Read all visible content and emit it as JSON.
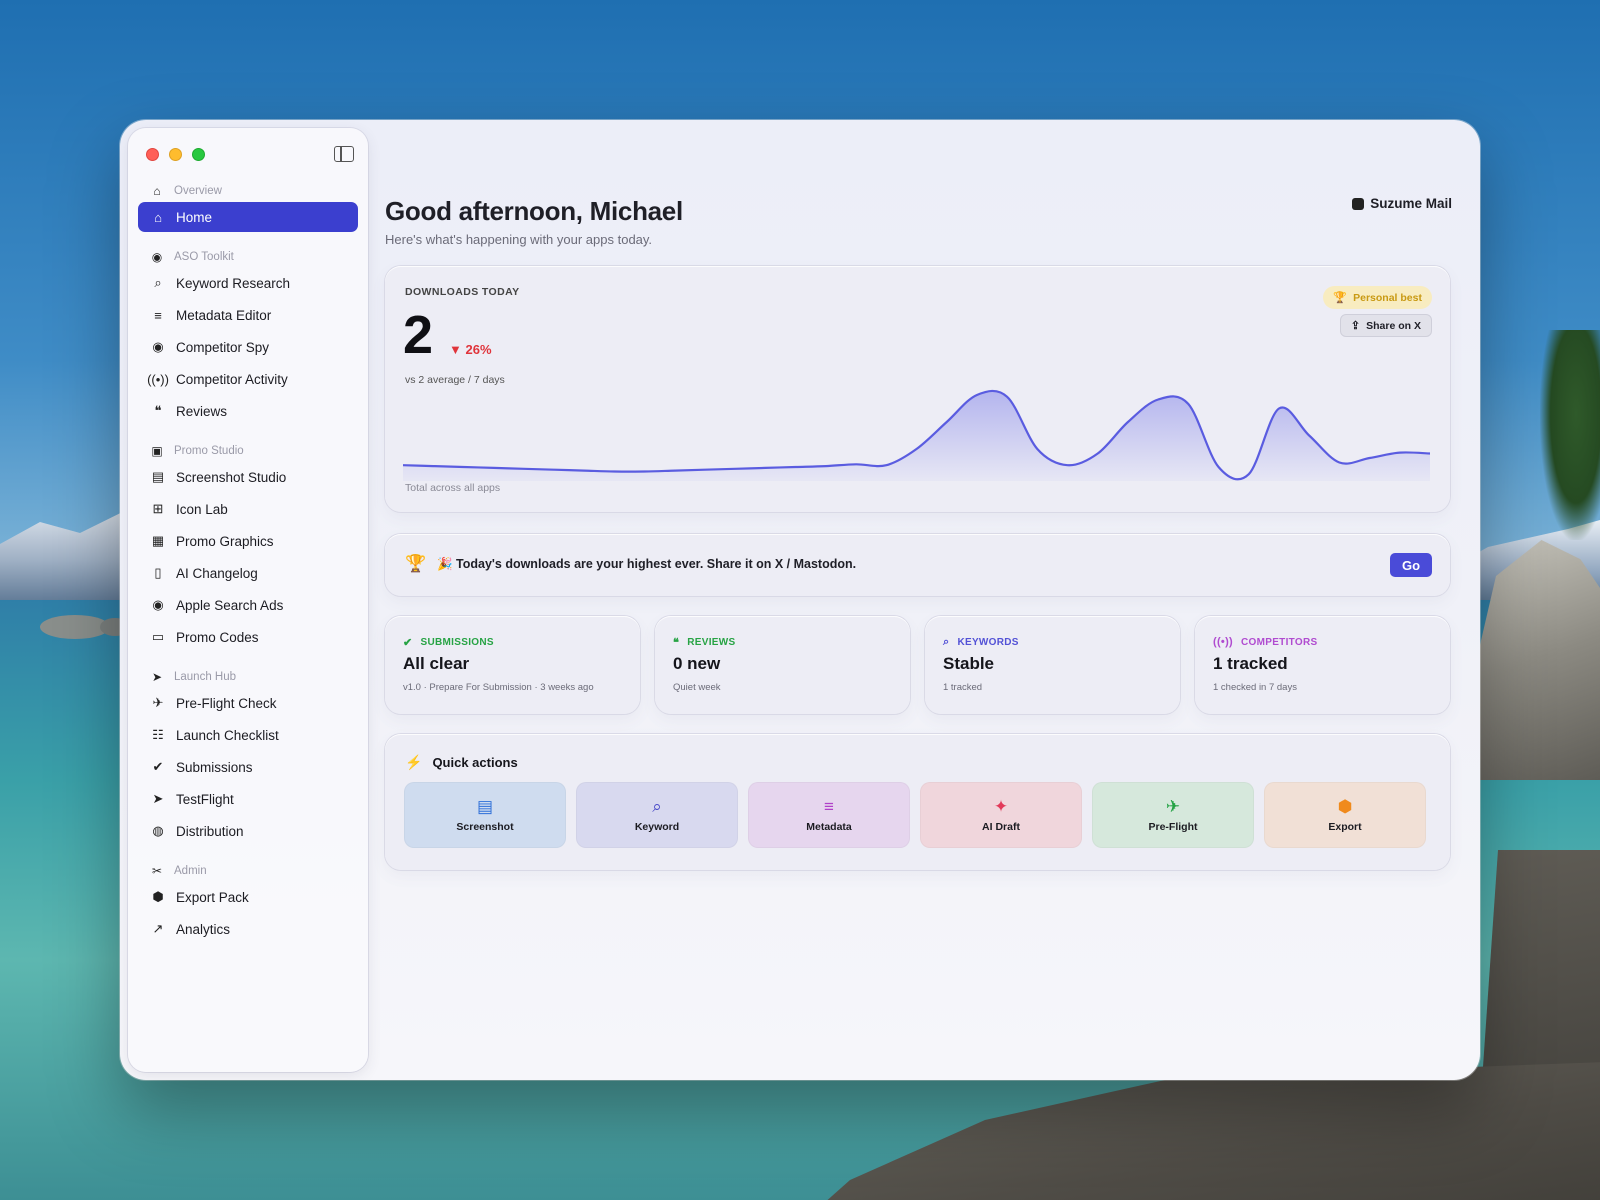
{
  "window": {
    "app_name": "Suzume Mail"
  },
  "sidebar": {
    "sections": [
      {
        "title": "Overview",
        "icon": "house-icon",
        "items": [
          {
            "label": "Home",
            "icon": "house-icon",
            "active": true
          }
        ]
      },
      {
        "title": "ASO Toolkit",
        "icon": "search-circle-icon",
        "items": [
          {
            "label": "Keyword Research",
            "icon": "magnifier-icon"
          },
          {
            "label": "Metadata Editor",
            "icon": "text-lines-icon"
          },
          {
            "label": "Competitor Spy",
            "icon": "eye-icon"
          },
          {
            "label": "Competitor Activity",
            "icon": "antenna-icon"
          },
          {
            "label": "Reviews",
            "icon": "speech-bubbles-icon"
          }
        ]
      },
      {
        "title": "Promo Studio",
        "icon": "bag-icon",
        "items": [
          {
            "label": "Screenshot Studio",
            "icon": "photos-icon"
          },
          {
            "label": "Icon Lab",
            "icon": "grid-icon"
          },
          {
            "label": "Promo Graphics",
            "icon": "blocks-icon"
          },
          {
            "label": "AI Changelog",
            "icon": "document-icon"
          },
          {
            "label": "Apple Search Ads",
            "icon": "search-circle-icon"
          },
          {
            "label": "Promo Codes",
            "icon": "ticket-icon"
          }
        ]
      },
      {
        "title": "Launch Hub",
        "icon": "paperplane-icon",
        "items": [
          {
            "label": "Pre-Flight Check",
            "icon": "airplane-icon"
          },
          {
            "label": "Launch Checklist",
            "icon": "checklist-icon"
          },
          {
            "label": "Submissions",
            "icon": "checkmark-seal-icon"
          },
          {
            "label": "TestFlight",
            "icon": "paperplane-icon"
          },
          {
            "label": "Distribution",
            "icon": "globe-icon"
          }
        ]
      },
      {
        "title": "Admin",
        "icon": "tools-icon",
        "items": [
          {
            "label": "Export Pack",
            "icon": "cube-icon"
          },
          {
            "label": "Analytics",
            "icon": "chart-line-icon"
          }
        ]
      }
    ]
  },
  "header": {
    "greeting": "Good afternoon, Michael",
    "subtitle": "Here's what's happening with your apps today."
  },
  "downloads": {
    "title": "DOWNLOADS TODAY",
    "value": "2",
    "delta": "▼ 26%",
    "compare": "vs 2 average / 7 days",
    "footer": "Total across all apps",
    "badge": "Personal best",
    "share_label": "Share on X",
    "accent": "#5a5ce0"
  },
  "chart_data": {
    "type": "area",
    "title": "",
    "xlabel": "",
    "ylabel": "",
    "series": [
      {
        "values": [
          0.12,
          0.11,
          0.1,
          0.09,
          0.08,
          0.07,
          0.06,
          0.05,
          0.05,
          0.06,
          0.07,
          0.08,
          0.09,
          0.1,
          0.11,
          0.13,
          0.12,
          0.3,
          0.6,
          0.9,
          0.88,
          0.3,
          0.12,
          0.25,
          0.6,
          0.85,
          0.8,
          0.1,
          0.02,
          0.75,
          0.45,
          0.15,
          0.2,
          0.26,
          0.25
        ]
      }
    ],
    "grid": false
  },
  "banner": {
    "text": "🎉 Today's downloads are your highest ever. Share it on X / Mastodon.",
    "button": "Go"
  },
  "stats": [
    {
      "label": "SUBMISSIONS",
      "value": "All clear",
      "sub": "v1.0 · Prepare For Submission · 3 weeks ago",
      "color": "#27a344",
      "icon": "checkmark-seal-icon"
    },
    {
      "label": "REVIEWS",
      "value": "0 new",
      "sub": "Quiet week",
      "color": "#27a344",
      "icon": "speech-bubbles-icon"
    },
    {
      "label": "KEYWORDS",
      "value": "Stable",
      "sub": "1 tracked",
      "color": "#5352d6",
      "icon": "magnifier-icon"
    },
    {
      "label": "COMPETITORS",
      "value": "1 tracked",
      "sub": "1 checked in 7 days",
      "color": "#b04bd0",
      "icon": "antenna-icon"
    }
  ],
  "quick_actions": {
    "title": "Quick actions",
    "items": [
      {
        "label": "Screenshot",
        "icon": "photos-icon",
        "bg": "#cfdcef",
        "fg": "#2e6fd8"
      },
      {
        "label": "Keyword",
        "icon": "magnifier-icon",
        "bg": "#d8d9ef",
        "fg": "#4748c8"
      },
      {
        "label": "Metadata",
        "icon": "text-lines-icon",
        "bg": "#e6d6ee",
        "fg": "#b040c8"
      },
      {
        "label": "AI Draft",
        "icon": "sparkles-icon",
        "bg": "#f0d6dc",
        "fg": "#e23a5a"
      },
      {
        "label": "Pre-Flight",
        "icon": "airplane-icon",
        "bg": "#d6e8dc",
        "fg": "#23a244"
      },
      {
        "label": "Export",
        "icon": "cube-icon",
        "bg": "#f1e0d6",
        "fg": "#f08a1c"
      }
    ]
  }
}
